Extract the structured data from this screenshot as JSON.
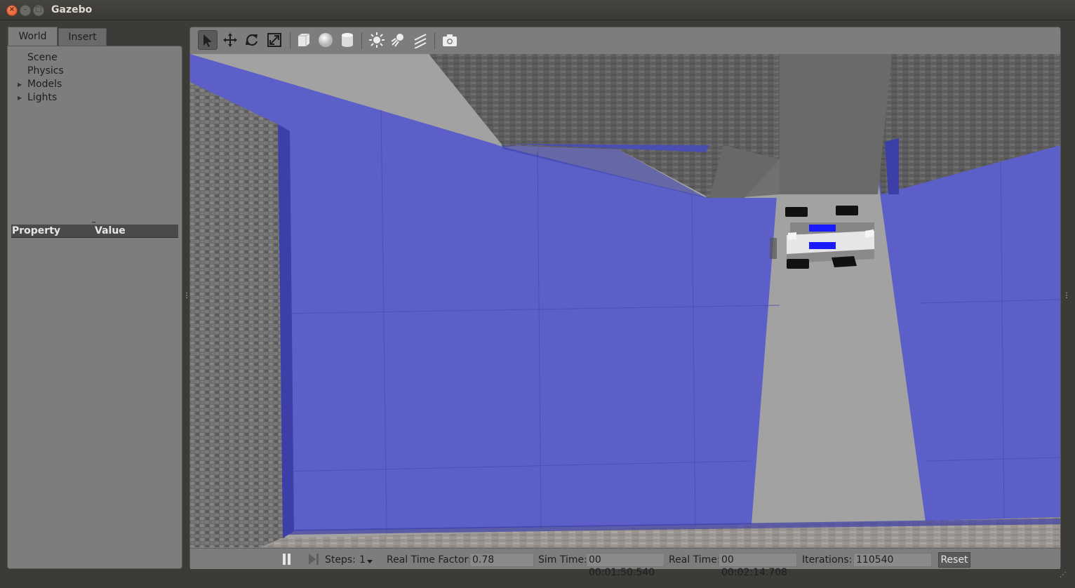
{
  "window": {
    "title": "Gazebo",
    "controls": [
      "close-icon",
      "minimize-icon",
      "maximize-icon"
    ]
  },
  "left_panel": {
    "tabs": [
      {
        "label": "World",
        "active": true
      },
      {
        "label": "Insert",
        "active": false
      }
    ],
    "tree": [
      {
        "label": "Scene",
        "expandable": false
      },
      {
        "label": "Physics",
        "expandable": false
      },
      {
        "label": "Models",
        "expandable": true
      },
      {
        "label": "Lights",
        "expandable": true
      }
    ],
    "property_table": {
      "columns": [
        "Property",
        "Value"
      ]
    }
  },
  "toolbar": {
    "tools": [
      {
        "name": "select-mode",
        "icon": "arrow-cursor-icon",
        "selected": true
      },
      {
        "name": "translate-mode",
        "icon": "move-arrows-icon",
        "selected": false
      },
      {
        "name": "rotate-mode",
        "icon": "rotate-icon",
        "selected": false
      },
      {
        "name": "scale-mode",
        "icon": "scale-icon",
        "selected": false
      },
      {
        "name": "box-shape",
        "icon": "box-icon",
        "selected": false
      },
      {
        "name": "sphere-shape",
        "icon": "sphere-icon",
        "selected": false
      },
      {
        "name": "cylinder-shape",
        "icon": "cylinder-icon",
        "selected": false
      },
      {
        "name": "point-light",
        "icon": "sun-icon",
        "selected": false
      },
      {
        "name": "spot-light",
        "icon": "spotlight-icon",
        "selected": false
      },
      {
        "name": "directional-light",
        "icon": "directional-light-icon",
        "selected": false
      },
      {
        "name": "screenshot",
        "icon": "camera-icon",
        "selected": false
      }
    ]
  },
  "scene": {
    "description_colors": {
      "blue_wall": "#5b5fc7",
      "ground": "#a2a2a2",
      "robot_accent": "#1a1aff"
    }
  },
  "bottom_bar": {
    "pause_icon": "pause-icon",
    "step_icon": "step-icon",
    "steps_label": "Steps:",
    "steps_value": "1",
    "rtf_label": "Real Time Factor:",
    "rtf_value": "0.78",
    "sim_time_label": "Sim Time:",
    "sim_time_value": "00 00:01:50.540",
    "real_time_label": "Real Time:",
    "real_time_value": "00 00:02:14.708",
    "iterations_label": "Iterations:",
    "iterations_value": "110540",
    "reset_label": "Reset"
  }
}
